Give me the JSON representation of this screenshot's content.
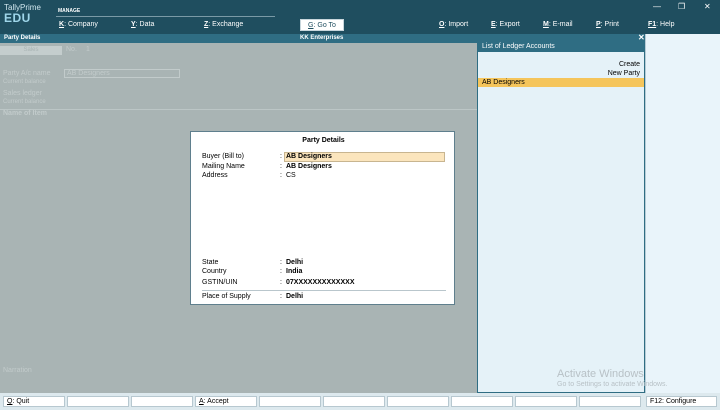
{
  "app": {
    "brand_line1": "TallyPrime",
    "brand_line2": "EDU"
  },
  "topbar": {
    "manage": "MANAGE",
    "menu": [
      {
        "key": "K",
        "label": ": Company"
      },
      {
        "key": "Y",
        "label": ": Data"
      },
      {
        "key": "Z",
        "label": ": Exchange"
      }
    ],
    "goto": {
      "key": "G",
      "label": ": Go To"
    },
    "actions": [
      {
        "key": "O",
        "label": ": Import"
      },
      {
        "key": "E",
        "label": ": Export"
      },
      {
        "key": "M",
        "label": ": E-mail"
      },
      {
        "key": "P",
        "label": ": Print"
      },
      {
        "key": "F1",
        "label": ": Help"
      }
    ]
  },
  "titlebar": {
    "left": "Party Details",
    "center": "KK Enterprises"
  },
  "background": {
    "no_label": "No.",
    "no_value": "1",
    "party_label": "Party A/c name",
    "party_value": "AB Designers",
    "current_balance": "Current balance",
    "sales_ledger": "Sales ledger",
    "name_of_item": "Name of Item",
    "narration": "Narration"
  },
  "panel": {
    "title": "List of Ledger Accounts",
    "create_line1": "Create",
    "create_line2": "New Party",
    "items": [
      "AB Designers"
    ]
  },
  "modal": {
    "title": "Party Details",
    "buyer_label": "Buyer (Bill to)",
    "buyer_value": "AB Designers",
    "mailing_label": "Mailing Name",
    "mailing_value": "AB Designers",
    "address_label": "Address",
    "address_value": "CS",
    "state_label": "State",
    "state_value": "Delhi",
    "country_label": "Country",
    "country_value": "India",
    "gstin_label": "GSTIN/UIN",
    "gstin_value": "07XXXXXXXXXXXXX",
    "pos_label": "Place of Supply",
    "pos_value": "Delhi"
  },
  "watermark": {
    "line1": "Activate Windows",
    "line2": "Go to Settings to activate Windows."
  },
  "bottombar": {
    "quit_key": "Q",
    "quit_label": ": Quit",
    "accept_key": "A",
    "accept_label": ": Accept",
    "configure": "F12: Configure"
  }
}
